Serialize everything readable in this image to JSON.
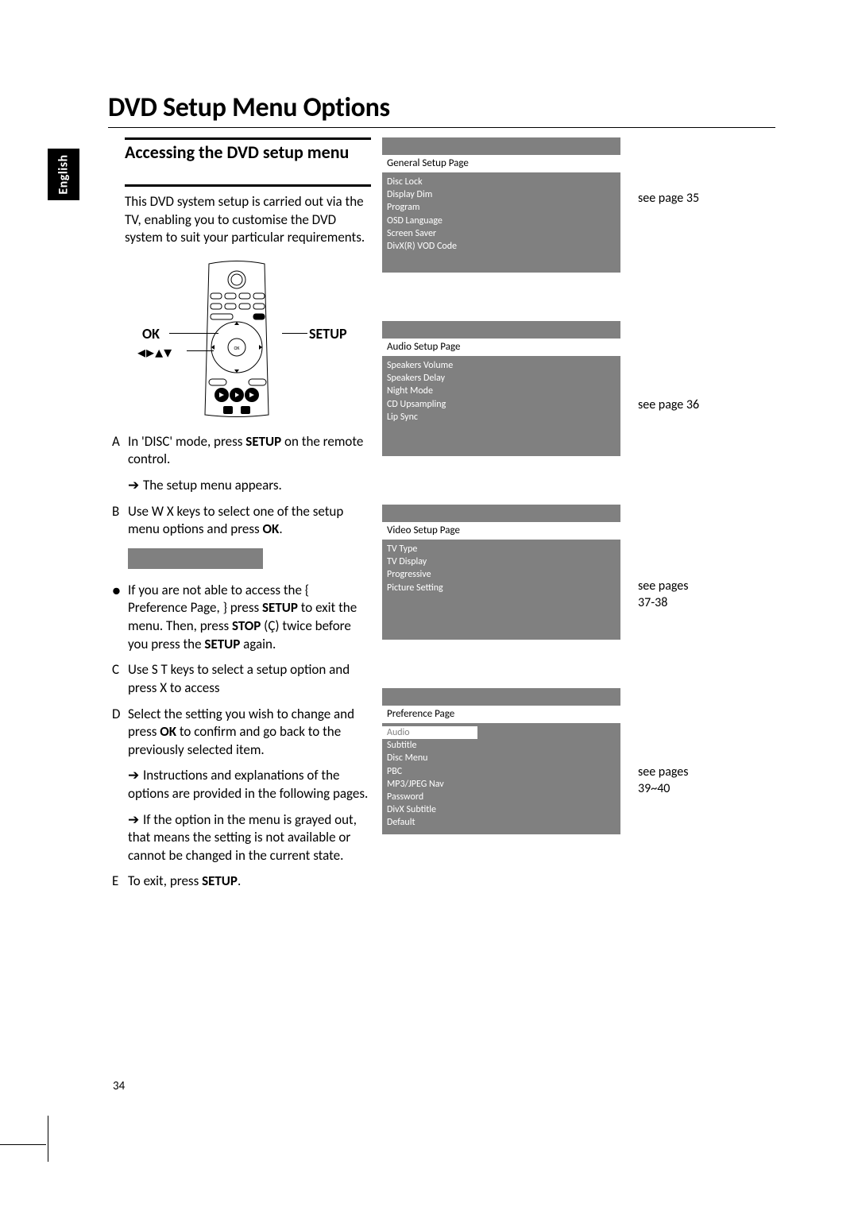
{
  "lang_tab": "English",
  "title": "DVD Setup Menu Options",
  "section": {
    "heading": "Accessing the DVD setup menu",
    "intro": "This DVD system setup is carried out via the TV, enabling you to customise the DVD system to suit your particular requirements."
  },
  "remote_labels": {
    "ok": "OK",
    "directions": "◂▸▴▾",
    "setup": "SETUP"
  },
  "steps": {
    "a_marker": "A",
    "a_text_1": "In 'DISC' mode, press ",
    "a_bold_1": "SETUP",
    "a_text_2": " on the remote control.",
    "a_sub": "The setup menu appears.",
    "b_marker": "B",
    "b_text_1": "Use  W X keys to select one of the setup menu options and press ",
    "b_bold_1": "OK",
    "b_text_2": ".",
    "bul_text_1": "If you are not able to access the { Preference Page, } press ",
    "bul_bold_1": "SETUP",
    "bul_text_2": " to exit the menu.  Then, press ",
    "bul_bold_2": "STOP",
    "bul_text_3": " (Ç) twice before you press the ",
    "bul_bold_3": "SETUP",
    "bul_text_4": " again.",
    "c_marker": "C",
    "c_text": "Use  S  T keys to select a setup option and press  X to access",
    "d_marker": "D",
    "d_text_1": "Select the setting you wish to change and press ",
    "d_bold_1": "OK",
    "d_text_2": " to confirm and go back to the previously selected item.",
    "d_sub1": "Instructions and explanations of the options are provided in the following pages.",
    "d_sub2": "If the option in the menu is grayed out, that means the setting is not available or cannot be changed in the current state.",
    "e_marker": "E",
    "e_text_1": "To exit, press ",
    "e_bold_1": "SETUP",
    "e_text_2": "."
  },
  "panels": [
    {
      "header": "General Setup Page",
      "items": [
        "Disc Lock",
        "Display Dim",
        "Program",
        "OSD Language",
        "Screen Saver",
        "DivX(R) VOD Code"
      ],
      "note": "see page 35"
    },
    {
      "header": "Audio Setup Page",
      "items": [
        "Speakers Volume",
        "Speakers Delay",
        "Night Mode",
        "CD Upsampling",
        "Lip Sync"
      ],
      "note": "see page 36"
    },
    {
      "header": "Video Setup Page",
      "items": [
        "TV Type",
        "TV Display",
        "Progressive",
        "Picture Setting"
      ],
      "note": "see pages 37-38"
    },
    {
      "header": "Preference Page",
      "items": [
        "Audio",
        "Subtitle",
        "Disc Menu",
        "PBC",
        "MP3/JPEG Nav",
        "Password",
        "DivX Subtitle",
        "Default"
      ],
      "note": "see pages 39~40"
    }
  ],
  "page_number": "34"
}
